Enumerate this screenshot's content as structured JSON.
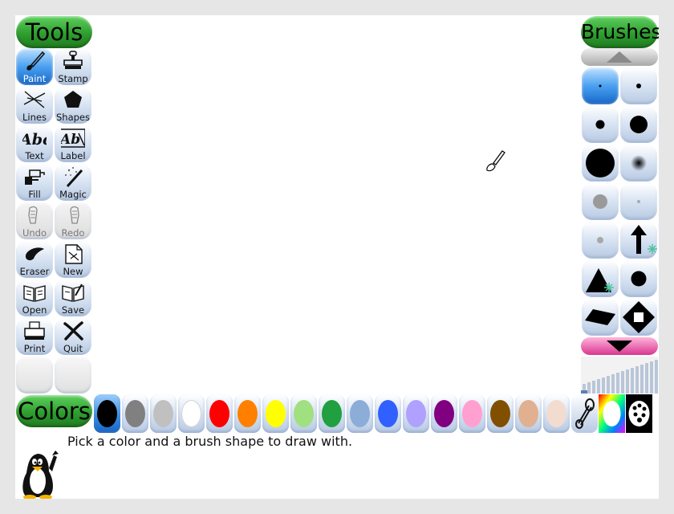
{
  "panels": {
    "tools_title": "Tools",
    "brushes_title": "Brushes",
    "colors_title": "Colors"
  },
  "tools": [
    {
      "label": "Paint",
      "icon": "paintbrush-icon",
      "state": "active"
    },
    {
      "label": "Stamp",
      "icon": "stamp-icon",
      "state": "normal"
    },
    {
      "label": "Lines",
      "icon": "lines-icon",
      "state": "normal"
    },
    {
      "label": "Shapes",
      "icon": "pentagon-icon",
      "state": "normal"
    },
    {
      "label": "Text",
      "icon": "text-abc-icon",
      "state": "normal"
    },
    {
      "label": "Label",
      "icon": "label-abc-icon",
      "state": "normal"
    },
    {
      "label": "Fill",
      "icon": "paint-bucket-icon",
      "state": "normal"
    },
    {
      "label": "Magic",
      "icon": "magic-wand-icon",
      "state": "normal"
    },
    {
      "label": "Undo",
      "icon": "undo-hand-icon",
      "state": "disabled"
    },
    {
      "label": "Redo",
      "icon": "redo-hand-icon",
      "state": "disabled"
    },
    {
      "label": "Eraser",
      "icon": "eraser-icon",
      "state": "normal"
    },
    {
      "label": "New",
      "icon": "new-page-icon",
      "state": "normal"
    },
    {
      "label": "Open",
      "icon": "open-book-icon",
      "state": "normal"
    },
    {
      "label": "Save",
      "icon": "save-book-icon",
      "state": "normal"
    },
    {
      "label": "Print",
      "icon": "printer-icon",
      "state": "normal"
    },
    {
      "label": "Quit",
      "icon": "quit-x-icon",
      "state": "normal"
    }
  ],
  "brushes": [
    {
      "shape": "tiny-dot",
      "active": true
    },
    {
      "shape": "small-dot"
    },
    {
      "shape": "medium-dot"
    },
    {
      "shape": "large-dot"
    },
    {
      "shape": "huge-dot"
    },
    {
      "shape": "soft-dot"
    },
    {
      "shape": "gray-dot"
    },
    {
      "shape": "faint-dot"
    },
    {
      "shape": "small-gray-dot"
    },
    {
      "shape": "arrow-up-animated"
    },
    {
      "shape": "triangle-animated"
    },
    {
      "shape": "circle"
    },
    {
      "shape": "parallelogram"
    },
    {
      "shape": "diamond-square"
    }
  ],
  "colors": [
    {
      "name": "black",
      "hex": "#000000",
      "active": true
    },
    {
      "name": "gray",
      "hex": "#808080"
    },
    {
      "name": "silver",
      "hex": "#c0c0c0"
    },
    {
      "name": "white",
      "hex": "#ffffff"
    },
    {
      "name": "red",
      "hex": "#ff0000"
    },
    {
      "name": "orange",
      "hex": "#ff8000"
    },
    {
      "name": "yellow",
      "hex": "#ffff00"
    },
    {
      "name": "light-green",
      "hex": "#a0e080"
    },
    {
      "name": "green",
      "hex": "#20a040"
    },
    {
      "name": "steel-blue",
      "hex": "#8cadd8"
    },
    {
      "name": "blue",
      "hex": "#3060ff"
    },
    {
      "name": "lavender",
      "hex": "#b0a0ff"
    },
    {
      "name": "purple",
      "hex": "#800080"
    },
    {
      "name": "pink",
      "hex": "#ffa0d0"
    },
    {
      "name": "brown",
      "hex": "#805000"
    },
    {
      "name": "tan",
      "hex": "#e0b090"
    },
    {
      "name": "skin",
      "hex": "#f2dcd0"
    }
  ],
  "special_colors": [
    "color-picker-icon",
    "rainbow-palette-icon",
    "color-mixer-icon"
  ],
  "status": {
    "message": "Pick a color and a brush shape to draw with."
  },
  "accent_colors": {
    "header_green": "#2f9e2f",
    "active_blue": "#1467c8",
    "scroll_down_pink": "#d9368f"
  }
}
